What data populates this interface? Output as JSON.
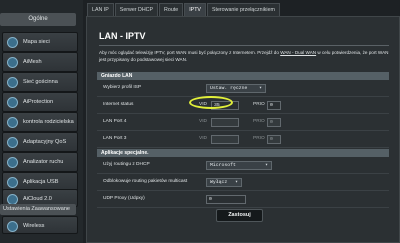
{
  "sidebar": {
    "header": "Ogólne",
    "items": [
      {
        "label": "Mapa sieci",
        "icon": "network-map-icon"
      },
      {
        "label": "AiMesh",
        "icon": "aimesh-icon"
      },
      {
        "label": "Sieć gościnna",
        "icon": "guest-network-icon"
      },
      {
        "label": "AiProtection",
        "icon": "shield-icon"
      },
      {
        "label": "kontrola rodzicielska",
        "icon": "parental-control-icon"
      },
      {
        "label": "Adaptacyjny QoS",
        "icon": "qos-icon"
      },
      {
        "label": "Analizator ruchu",
        "icon": "traffic-analyzer-icon"
      },
      {
        "label": "Aplikacja USB",
        "icon": "usb-icon"
      },
      {
        "label": "AiCloud 2.0",
        "icon": "cloud-icon"
      }
    ],
    "advanced_header": "Ustawienia Zaawansowane",
    "advanced_items": [
      {
        "label": "Wireless",
        "icon": "wireless-icon"
      }
    ]
  },
  "tabs": [
    {
      "label": "LAN IP",
      "active": false
    },
    {
      "label": "Serwer DHCP",
      "active": false
    },
    {
      "label": "Route",
      "active": false
    },
    {
      "label": "IPTV",
      "active": true
    },
    {
      "label": "Sterowanie przełącznikiem",
      "active": false
    }
  ],
  "main": {
    "title": "LAN - IPTV",
    "description_part1": "Aby móc oglądać telewizję IPTV, port WAN musi być połączony z Internetem. Przejdź do",
    "description_link": "WAN - Dual WAN",
    "description_part2": "w celu potwierdzenia, że port WAN jest przypisany do podstawowej sieci WAN."
  },
  "gniazdo_lan": {
    "section_title": "Gniazdo LAN",
    "profile_label": "Wybierz profil ISP",
    "profile_value": "Ustaw. ręczne",
    "internet_label": "Internet status",
    "internet_vid_label": "VID",
    "internet_vid_value": "35",
    "internet_prio_label": "PRIO",
    "internet_prio_value": "0",
    "port4_label": "LAN Port 4",
    "port4_vid_label": "VID",
    "port4_prio_label": "PRIO",
    "port4_prio_value": "0",
    "port3_label": "LAN Port 3",
    "port3_vid_label": "VID",
    "port3_prio_label": "PRIO",
    "port3_prio_value": "0"
  },
  "aplikacje": {
    "section_title": "Aplikacje specjalne.",
    "dhcp_label": "Użyj routingu z DHCP",
    "dhcp_value": "Microsoft",
    "multicast_label": "Odblokowuje routing pakietów multicast",
    "multicast_value": "Wyłącz",
    "udp_label": "UDP Proxy (Udpxy)",
    "udp_value": "0"
  },
  "apply_button": "Zastosuj",
  "colors": {
    "highlight": "#e2f03a",
    "background": "#1d2124"
  }
}
